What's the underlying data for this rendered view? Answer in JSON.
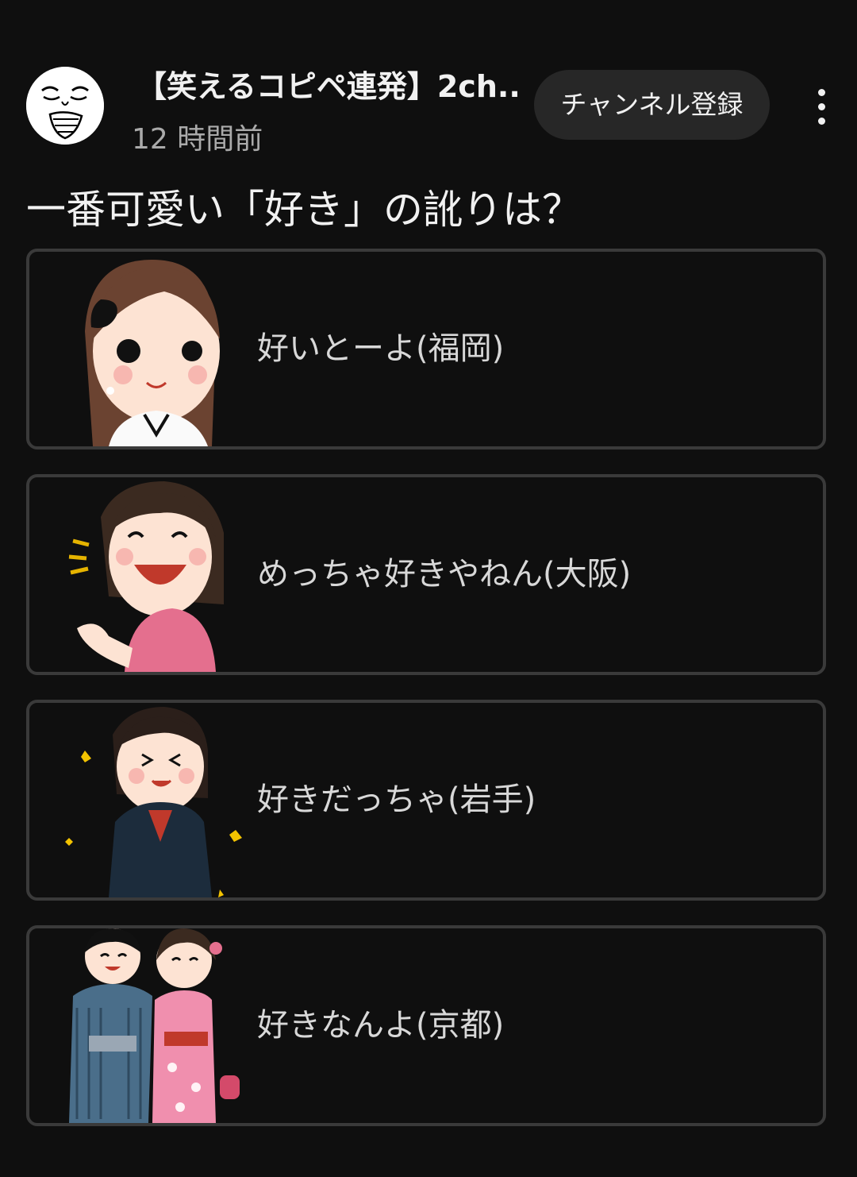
{
  "post": {
    "channel_name": "【笑えるコピペ連発】2ch...",
    "time": "12 時間前",
    "subscribe_label": "チャンネル登録",
    "question": "一番可愛い「好き」の訛りは？",
    "options": [
      {
        "label": "好いとーよ(福岡)",
        "icon": "girl-ribbon-illustration"
      },
      {
        "label": "めっちゃ好きやねん(大阪)",
        "icon": "laughing-girl-illustration"
      },
      {
        "label": "好きだっちゃ(岩手)",
        "icon": "schoolgirl-sparkle-illustration"
      },
      {
        "label": "好きなんよ(京都)",
        "icon": "yukata-couple-illustration"
      }
    ]
  },
  "colors": {
    "background": "#0f0f0f",
    "option_border": "#3a3a3a",
    "button_bg": "#272727",
    "secondary_text": "#aaaaaa"
  }
}
